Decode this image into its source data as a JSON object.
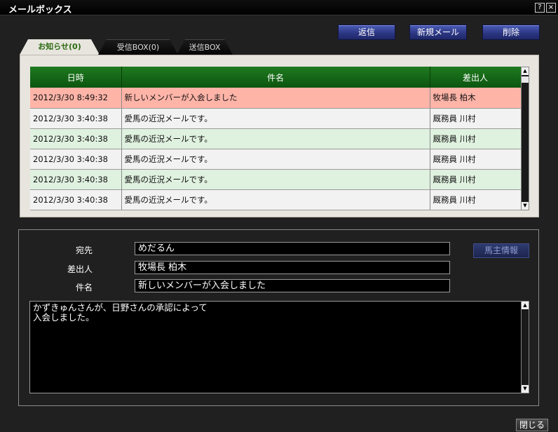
{
  "window": {
    "title": "メールボックス",
    "help_label": "?",
    "close_label": "×"
  },
  "toolbar": {
    "reply_label": "返信",
    "new_mail_label": "新規メール",
    "delete_label": "削除"
  },
  "tabs": [
    {
      "label": "お知らせ(0)",
      "active": true
    },
    {
      "label": "受信BOX(0)",
      "active": false
    },
    {
      "label": "送信BOX",
      "active": false
    }
  ],
  "table": {
    "headers": [
      "日時",
      "件名",
      "差出人"
    ],
    "rows": [
      {
        "date": "2012/3/30 8:49:32",
        "subject": "新しいメンバーが入会しました",
        "sender": "牧場長 柏木",
        "selected": true
      },
      {
        "date": "2012/3/30 3:40:38",
        "subject": "愛馬の近況メールです。",
        "sender": "厩務員 川村"
      },
      {
        "date": "2012/3/30 3:40:38",
        "subject": "愛馬の近況メールです。",
        "sender": "厩務員 川村"
      },
      {
        "date": "2012/3/30 3:40:38",
        "subject": "愛馬の近況メールです。",
        "sender": "厩務員 川村"
      },
      {
        "date": "2012/3/30 3:40:38",
        "subject": "愛馬の近況メールです。",
        "sender": "厩務員 川村"
      },
      {
        "date": "2012/3/30 3:40:38",
        "subject": "愛馬の近況メールです。",
        "sender": "厩務員 川村"
      }
    ]
  },
  "detail": {
    "to_label": "宛先",
    "to_value": "めだるん",
    "from_label": "差出人",
    "from_value": "牧場長 柏木",
    "subject_label": "件名",
    "subject_value": "新しいメンバーが入会しました",
    "owner_info_label": "馬主情報",
    "body": "かずきゅんさんが、日野さんの承認によって\n入会しました。"
  },
  "footer": {
    "close_label": "閉じる"
  },
  "colors": {
    "header_green": "#1f7a1f",
    "selected_row": "#ffb4a8",
    "alt_row_green": "#dff1df",
    "button_blue": "#2b3580"
  },
  "icons": {
    "scroll_up": "arrow-up-icon",
    "scroll_down": "arrow-down-icon"
  }
}
